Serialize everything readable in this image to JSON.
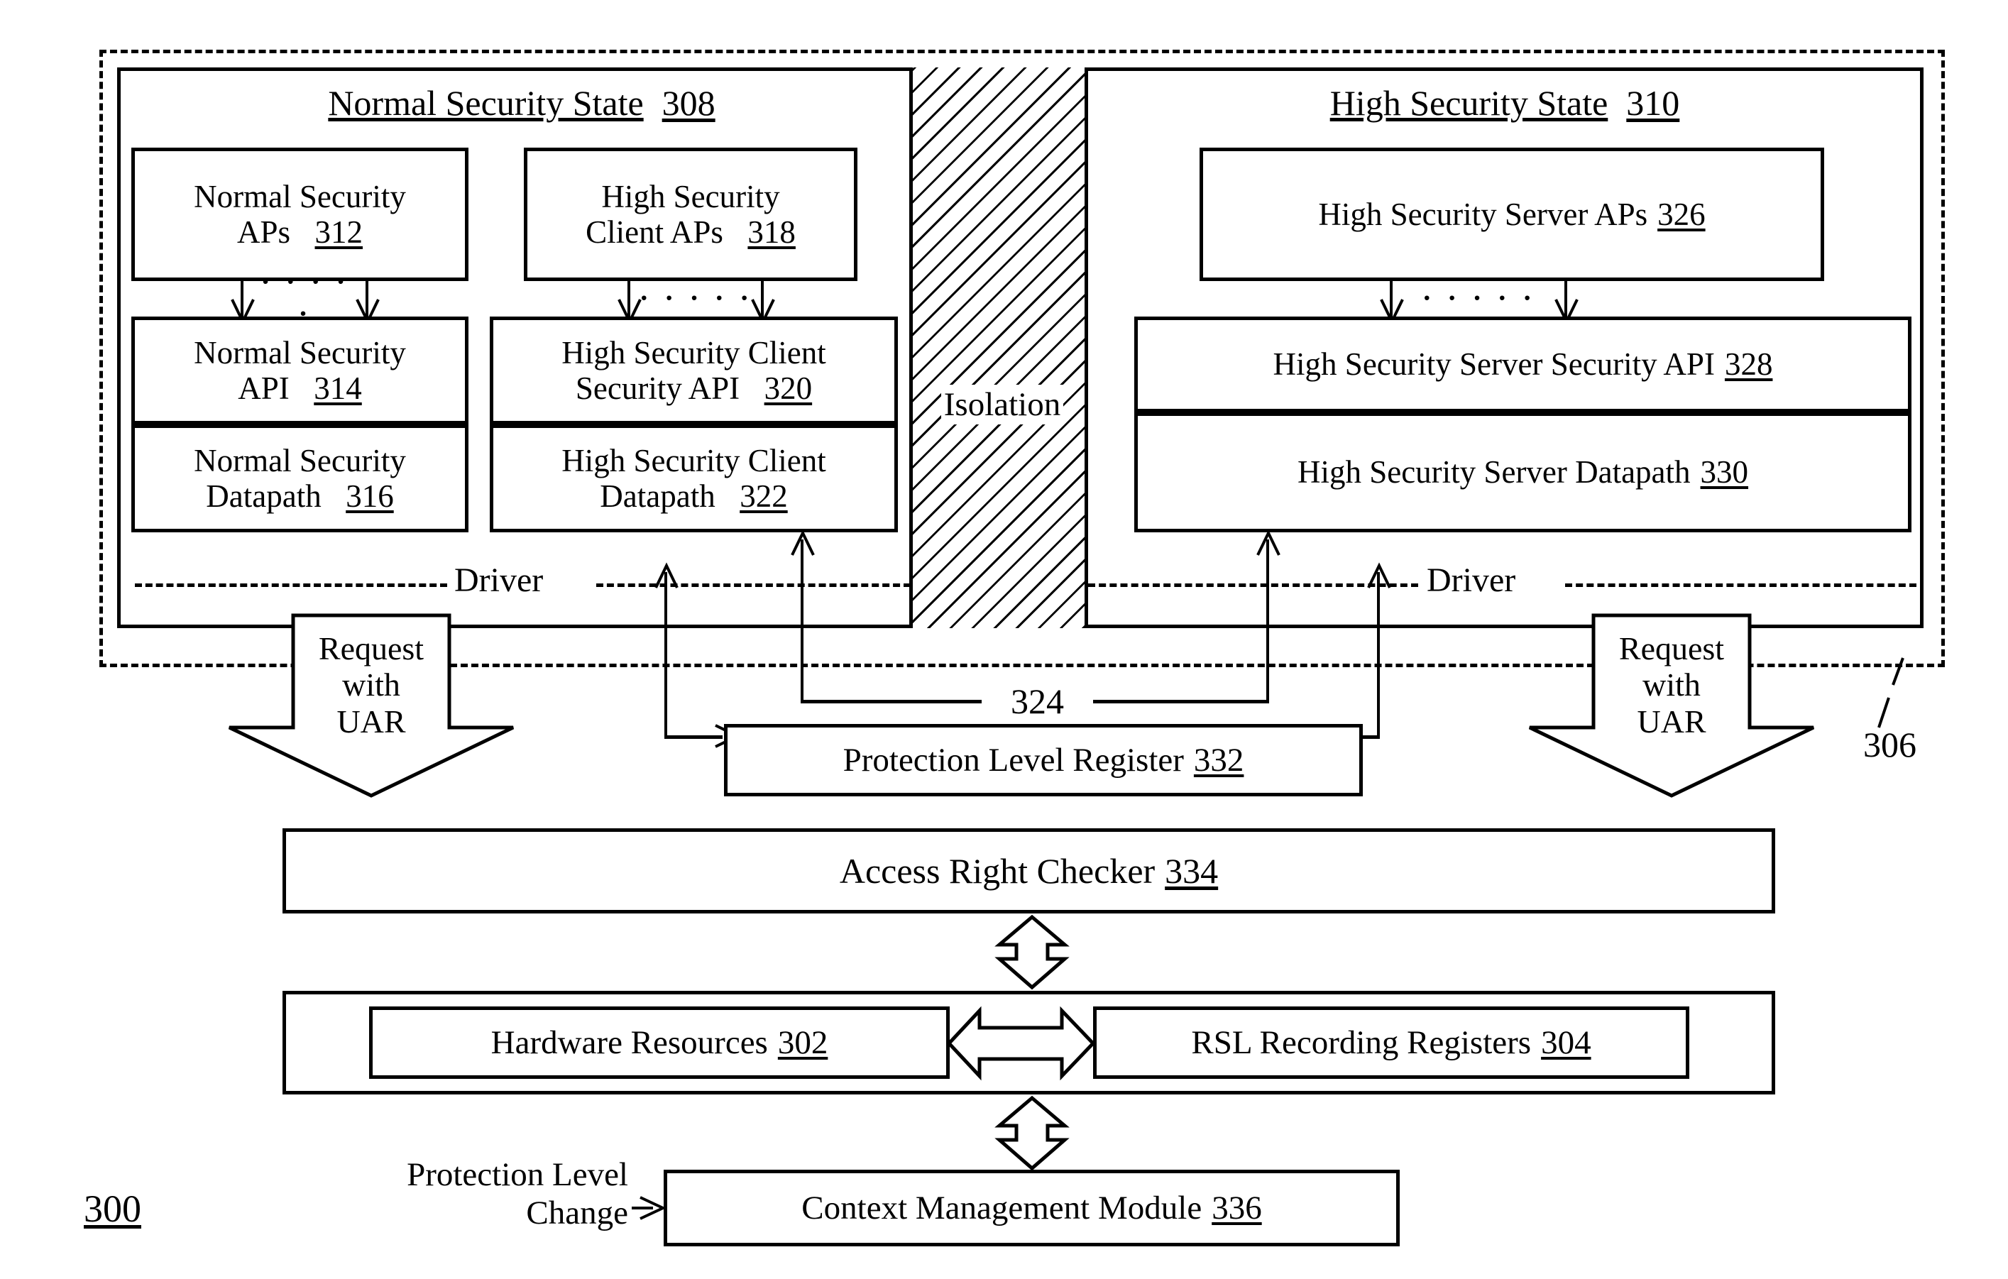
{
  "figure": {
    "figure_number": "300",
    "outer_region_label": "306",
    "interconnect_label": "324",
    "driver_label_left": "Driver",
    "driver_label_right": "Driver",
    "isolation_label": "Isolation"
  },
  "normal_state": {
    "title": "Normal Security State",
    "number": "308",
    "aps": {
      "line1": "Normal Security",
      "line2": "APs",
      "number": "312"
    },
    "api": {
      "line1": "Normal Security",
      "line2": "API",
      "number": "314"
    },
    "datapath": {
      "line1": "Normal Security",
      "line2": "Datapath",
      "number": "316"
    },
    "client_aps": {
      "line1": "High Security",
      "line2": "Client APs",
      "number": "318"
    },
    "client_api": {
      "line1": "High Security Client",
      "line2": "Security API",
      "number": "320"
    },
    "client_datapath": {
      "line1": "High Security Client",
      "line2": "Datapath",
      "number": "322"
    }
  },
  "high_state": {
    "title": "High Security State",
    "number": "310",
    "server_aps": {
      "text": "High Security Server APs",
      "number": "326"
    },
    "server_api": {
      "text": "High Security Server Security API",
      "number": "328"
    },
    "server_datapath": {
      "text": "High Security Server Datapath",
      "number": "330"
    }
  },
  "requests": {
    "left": {
      "line1": "Request",
      "line2": "with",
      "line3": "UAR"
    },
    "right": {
      "line1": "Request",
      "line2": "with",
      "line3": "UAR"
    }
  },
  "blocks": {
    "protection_level_register": {
      "text": "Protection Level Register",
      "number": "332"
    },
    "access_right_checker": {
      "text": "Access Right Checker",
      "number": "334"
    },
    "hardware_resources": {
      "text": "Hardware Resources",
      "number": "302"
    },
    "rsl_recording_registers": {
      "text": "RSL Recording Registers",
      "number": "304"
    },
    "context_management_module": {
      "text": "Context Management Module",
      "number": "336"
    }
  },
  "annotations": {
    "protection_level_change": {
      "line1": "Protection Level",
      "line2": "Change"
    }
  },
  "dots": "· · · · ·",
  "colors": {
    "stroke": "#000000",
    "background": "#ffffff"
  }
}
